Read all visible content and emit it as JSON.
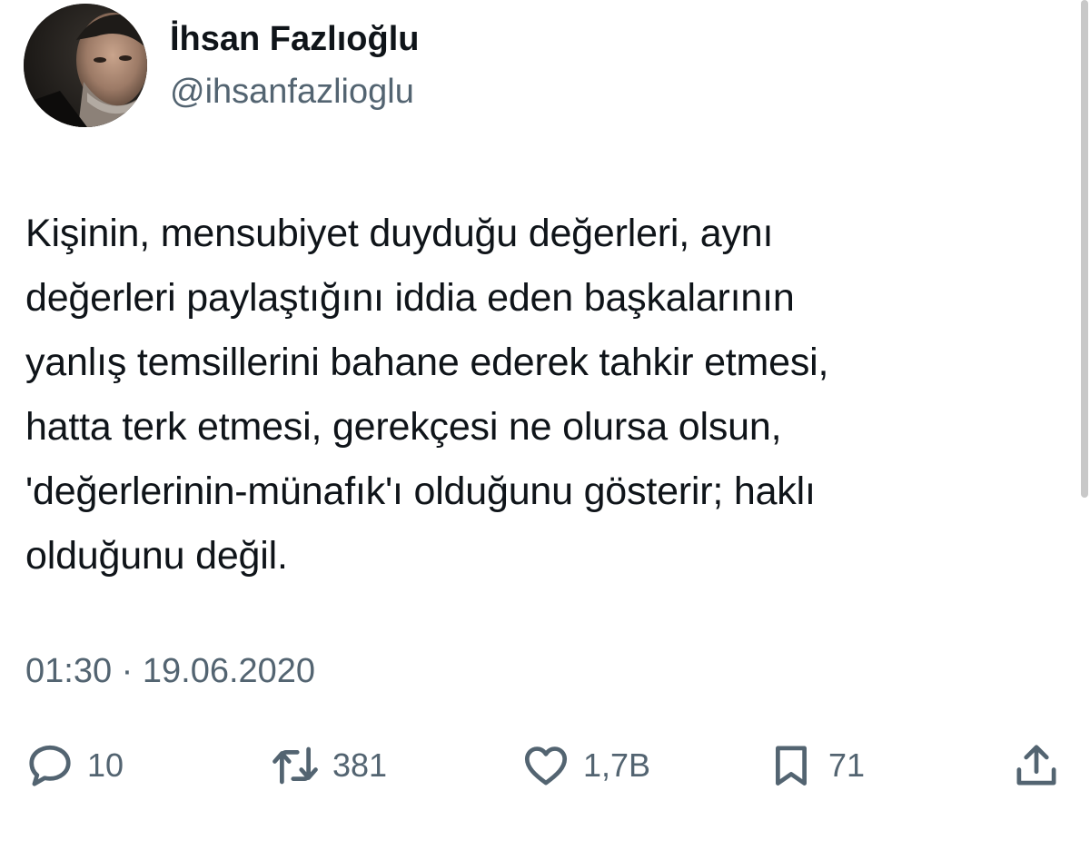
{
  "author": {
    "display_name": "İhsan Fazlıoğlu",
    "handle": "@ihsanfazlioglu"
  },
  "tweet": {
    "text": "Kişinin, mensubiyet duyduğu değerleri, aynı\ndeğerleri paylaştığını iddia  eden başkalarının\nyanlış temsillerini bahane ederek tahkir etmesi,\nhatta terk etmesi, gerekçesi ne olursa olsun,\n'değerlerinin-münafık'ı olduğunu gösterir; haklı\nolduğunu değil.",
    "timestamp": "01:30 · 19.06.2020"
  },
  "actions": {
    "reply": {
      "icon": "reply-icon",
      "count": "10"
    },
    "retweet": {
      "icon": "retweet-icon",
      "count": "381"
    },
    "like": {
      "icon": "heart-icon",
      "count": "1,7B"
    },
    "bookmark": {
      "icon": "bookmark-icon",
      "count": "71"
    },
    "share": {
      "icon": "share-icon"
    }
  },
  "colors": {
    "text": "#0f1419",
    "secondary_text": "#536471",
    "background": "#ffffff"
  }
}
